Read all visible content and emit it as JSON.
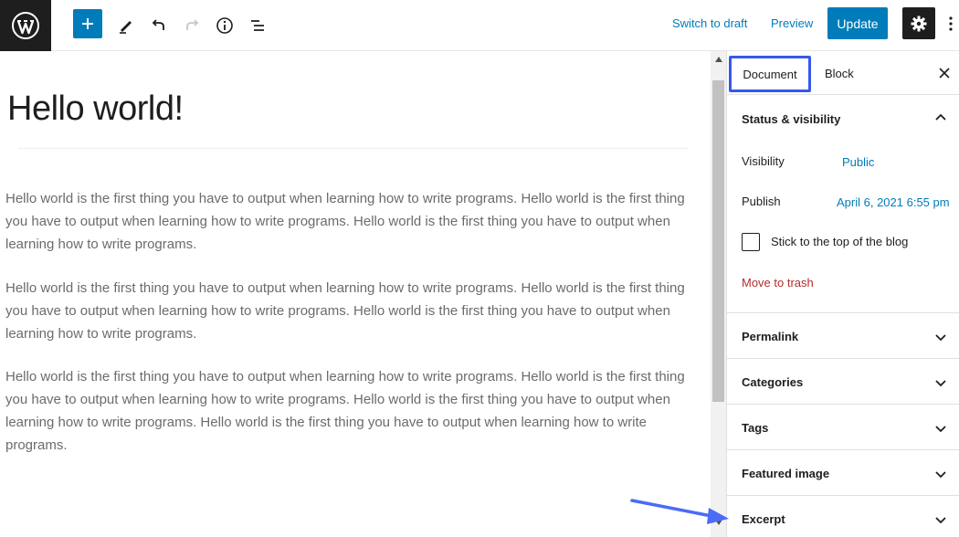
{
  "header": {
    "switch_to_draft": "Switch to draft",
    "preview": "Preview",
    "update": "Update"
  },
  "editor": {
    "title": "Hello world!",
    "paragraphs": [
      "Hello world is the first thing you have to output when learning how to write programs. Hello world is the first thing you have to output when learning how to write programs. Hello world is the first thing you have to output when learning how to write programs.",
      "Hello world is the first thing you have to output when learning how to write programs. Hello world is the first thing you have to output when learning how to write programs. Hello world is the first thing you have to output when learning how to write programs.",
      "Hello world is the first thing you have to output when learning how to write programs. Hello world is the first thing you have to output when learning how to write programs. Hello world is the first thing you have to output when learning how to write programs. Hello world is the first thing you have to output when learning how to write programs."
    ]
  },
  "sidebar": {
    "tabs": {
      "document": "Document",
      "block": "Block"
    },
    "status": {
      "title": "Status & visibility",
      "visibility_label": "Visibility",
      "visibility_value": "Public",
      "publish_label": "Publish",
      "publish_value": "April 6, 2021 6:55 pm",
      "sticky_label": "Stick to the top of the blog",
      "trash": "Move to trash"
    },
    "panels": [
      "Permalink",
      "Categories",
      "Tags",
      "Featured image",
      "Excerpt"
    ]
  },
  "colors": {
    "accent": "#007cba",
    "focus": "#3858e9",
    "danger": "#b32d2e",
    "dark": "#1e1e1e"
  }
}
